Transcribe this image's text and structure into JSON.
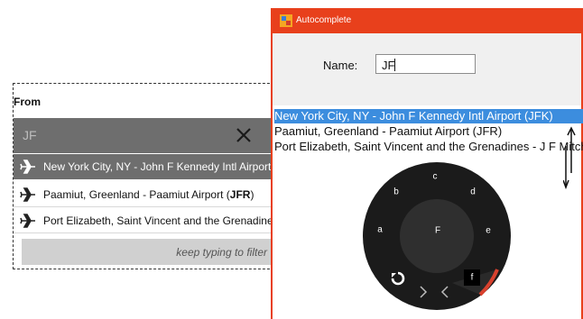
{
  "left_panel": {
    "from_label": "From",
    "search_value": "JF",
    "clear_icon": "close-icon",
    "results": [
      {
        "text": "New York City, NY - John F Kennedy Intl Airport (JFK)",
        "active": true
      },
      {
        "pre": "Paamiut, Greenland - Paamiut Airport (",
        "bold": "JFR",
        "post": ")",
        "active": false
      },
      {
        "text": "Port Elizabeth, Saint Vincent and the Grenadines - J F Mitchell Airport (BQU)",
        "active": false
      }
    ],
    "result_icon": "airplane-icon",
    "hint": "keep typing to filter"
  },
  "window": {
    "title": "Autocomplete",
    "app_icon": "app-icon",
    "name_label": "Name:",
    "name_value": "JF",
    "list": [
      "New York City, NY - John F Kennedy Intl Airport (JFK)",
      "Paamiut, Greenland - Paamiut Airport (JFR)",
      "Port Elizabeth, Saint Vincent and the Grenadines - J F Mitchell Airport (BQU)"
    ],
    "selected_index": 0
  },
  "radial_keyboard": {
    "keys": [
      "a",
      "b",
      "c",
      "d",
      "e"
    ],
    "center_key": "F",
    "corner_key": "f",
    "undo_icon": "undo-icon",
    "nav_icons": [
      "chevron-right-icon",
      "chevron-left-icon"
    ],
    "accent_color": "#d8412e"
  },
  "colors": {
    "title_bar": "#e8401c",
    "selection": "#3c8dde",
    "search_bar": "#6e6e6e"
  }
}
